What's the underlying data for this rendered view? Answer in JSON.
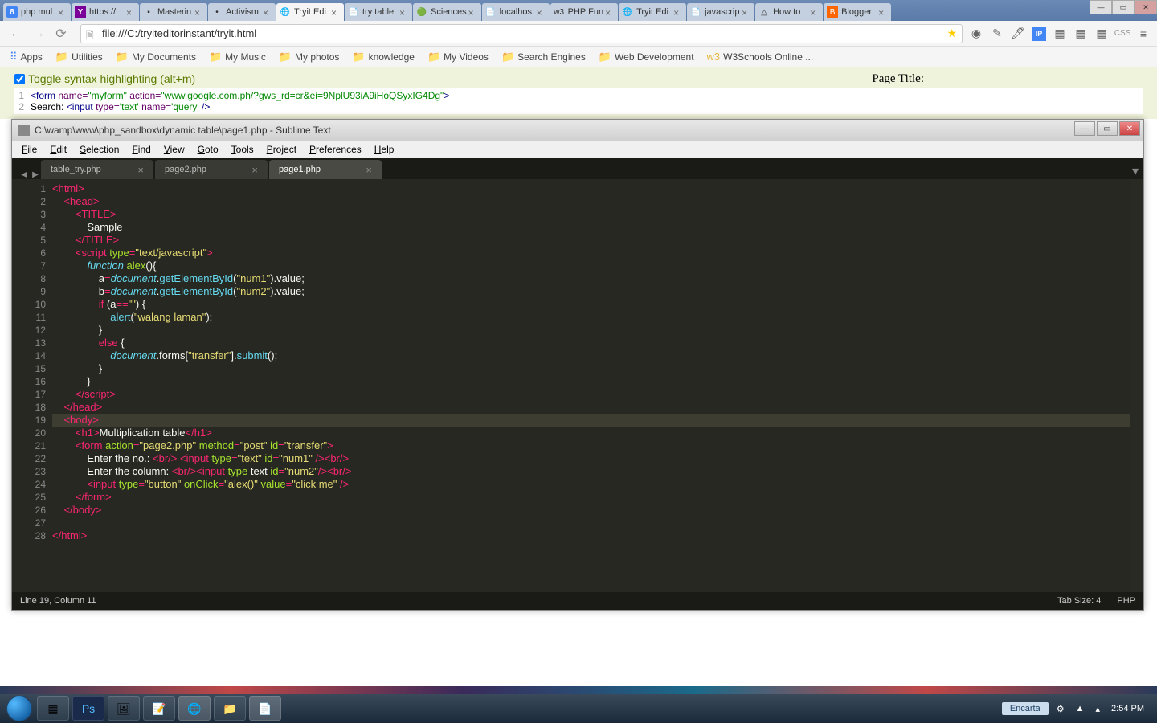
{
  "chrome": {
    "tabs": [
      {
        "title": "php mul",
        "favicon": "8",
        "favclass": "fav-g"
      },
      {
        "title": "https://",
        "favicon": "Y",
        "favclass": "fav-y"
      },
      {
        "title": "Masterin",
        "favicon": "▪",
        "favclass": ""
      },
      {
        "title": "Activism",
        "favicon": "•",
        "favclass": ""
      },
      {
        "title": "Tryit Edi",
        "favicon": "🌐",
        "favclass": ""
      },
      {
        "title": "try table",
        "favicon": "📄",
        "favclass": ""
      },
      {
        "title": "Sciences",
        "favicon": "🟢",
        "favclass": ""
      },
      {
        "title": "localhos",
        "favicon": "📄",
        "favclass": ""
      },
      {
        "title": "PHP Fun",
        "favicon": "w3",
        "favclass": ""
      },
      {
        "title": "Tryit Edi",
        "favicon": "🌐",
        "favclass": ""
      },
      {
        "title": "javascrip",
        "favicon": "📄",
        "favclass": ""
      },
      {
        "title": "How to",
        "favicon": "△",
        "favclass": ""
      },
      {
        "title": "Blogger:",
        "favicon": "B",
        "favclass": "fav-b"
      }
    ],
    "url": "file:///C:/tryiteditorinstant/tryit.html",
    "bookmarks": [
      {
        "label": "Apps",
        "icon": "⠿",
        "cls": "apps"
      },
      {
        "label": "Utilities",
        "icon": "📁"
      },
      {
        "label": "My Documents",
        "icon": "📁"
      },
      {
        "label": "My Music",
        "icon": "📁"
      },
      {
        "label": "My photos",
        "icon": "📁"
      },
      {
        "label": "knowledge",
        "icon": "📁"
      },
      {
        "label": "My Videos",
        "icon": "📁"
      },
      {
        "label": "Search Engines",
        "icon": "📁"
      },
      {
        "label": "Web Development",
        "icon": "📁"
      },
      {
        "label": "W3Schools Online ...",
        "icon": "w3"
      }
    ]
  },
  "tryit": {
    "toggle_label": "Toggle syntax highlighting (alt+m)",
    "page_title_label": "Page Title:",
    "code_lines": [
      "<form name=\"myform\" action=\"www.google.com.ph/?gws_rd=cr&ei=9NplU93iA9iHoQSyxIG4Dg\">",
      "Search: <input type='text' name='query' />"
    ]
  },
  "sublime": {
    "title": "C:\\wamp\\www\\php_sandbox\\dynamic table\\page1.php - Sublime Text",
    "menus": [
      "File",
      "Edit",
      "Selection",
      "Find",
      "View",
      "Goto",
      "Tools",
      "Project",
      "Preferences",
      "Help"
    ],
    "tabs": [
      {
        "name": "table_try.php",
        "active": false
      },
      {
        "name": "page2.php",
        "active": false
      },
      {
        "name": "page1.php",
        "active": true
      }
    ],
    "status_left": "Line 19, Column 11",
    "status_tab": "Tab Size: 4",
    "status_lang": "PHP",
    "active_line": 19,
    "line_count": 28
  },
  "taskbar": {
    "encarta": "Encarta",
    "time": "2:54 PM"
  }
}
